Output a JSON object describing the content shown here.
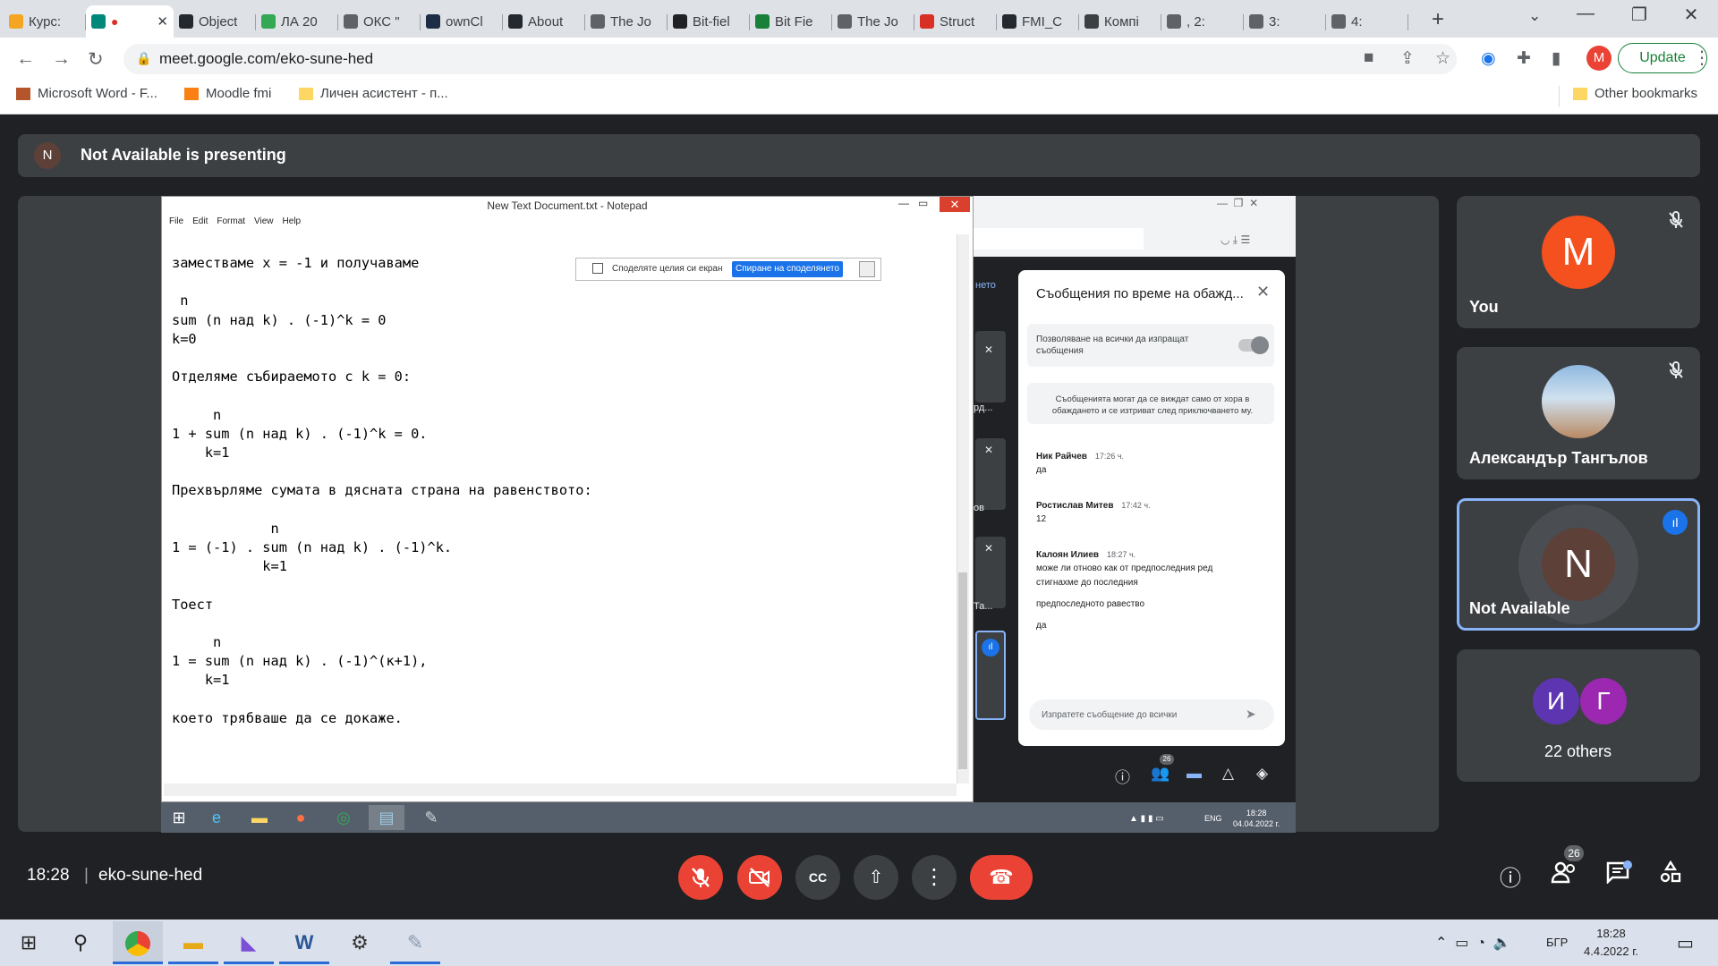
{
  "browser": {
    "tabs": [
      {
        "title": "Курс: ",
        "color": "#f4a623"
      },
      {
        "title": "",
        "color": "#00897b",
        "active": true,
        "recording": true
      },
      {
        "title": "Object",
        "color": "#24292f"
      },
      {
        "title": "ЛА 20",
        "color": "#34a853"
      },
      {
        "title": "ОКС \"",
        "color": "#5f6368"
      },
      {
        "title": "ownCl",
        "color": "#1d2d44"
      },
      {
        "title": "About",
        "color": "#24292f"
      },
      {
        "title": "The Jo",
        "color": "#5f6368"
      },
      {
        "title": "Bit-fiel",
        "color": "#202124"
      },
      {
        "title": "Bit Fie",
        "color": "#188038"
      },
      {
        "title": "The Jo",
        "color": "#5f6368"
      },
      {
        "title": "Struct",
        "color": "#d93025"
      },
      {
        "title": "FMI_C",
        "color": "#24292f"
      },
      {
        "title": "Компі",
        "color": "#3c4043"
      },
      {
        "title": ", 2:",
        "color": "#5f6368"
      },
      {
        "title": "3:",
        "color": "#5f6368"
      },
      {
        "title": "4:",
        "color": "#5f6368"
      }
    ],
    "url": "meet.google.com/eko-sune-hed",
    "profile_initial": "M",
    "update_label": "Update",
    "bookmarks": [
      "Microsoft Word - F...",
      "Moodle fmi",
      "Личен асистент - п..."
    ],
    "other_bookmarks": "Other bookmarks"
  },
  "meet": {
    "presenting_initial": "N",
    "presenting_text": "Not Available is presenting",
    "time": "18:28",
    "meeting_code": "eko-sune-hed",
    "participants_count": "26",
    "participants": [
      {
        "name": "You",
        "initial": "M",
        "color": "#f4511e",
        "muted": true
      },
      {
        "name": "Александър Тангълов",
        "muted": true
      },
      {
        "name": "Not Available",
        "initial": "N",
        "color": "#5d4037",
        "speaking": true
      },
      {
        "name": "22 others",
        "initials": [
          "И",
          "Г"
        ]
      }
    ]
  },
  "shared_screen": {
    "notepad": {
      "title": "New Text Document.txt - Notepad",
      "menu": [
        "File",
        "Edit",
        "Format",
        "View",
        "Help"
      ],
      "content": "заместваме x = -1 и получаваме\n\n n\nsum (n над k) . (-1)^k = 0\nk=0\n\nОтделяме събираемото с k = 0:\n\n     n\n1 + sum (n над k) . (-1)^k = 0.\n    k=1\n\nПрехвърляме сумата в дясната страна на равенството:\n\n            n\n1 = (-1) . sum (n над k) . (-1)^k.\n           k=1\n\nТоест\n\n     n\n1 = sum (n над k) . (-1)^(к+1),\n    k=1\n\nкоето трябваше да се докаже."
    },
    "share_bar": {
      "message": "Споделяте целия си екран",
      "stop_label": "Спиране на споделянето"
    },
    "remote_meet": {
      "share_tab": "нето",
      "side_labels": [
        "рд...",
        "ов",
        "Та..."
      ],
      "participants_badge": "26",
      "chat_panel": {
        "title": "Съобщения по време на обажд...",
        "toggle_label": "Позволяване на всички да изпращат съобщения",
        "notice": "Съобщенията могат да се виждат само от хора в обаждането и се изтриват след приключването му.",
        "messages": [
          {
            "author": "Ник Райчев",
            "time": "17:26 ч.",
            "lines": [
              "да"
            ]
          },
          {
            "author": "Ростислав Митев",
            "time": "17:42 ч.",
            "lines": [
              "12"
            ]
          },
          {
            "author": "Калоян Илиев",
            "time": "18:27 ч.",
            "lines": [
              "може ли отново как от предпоследния ред",
              "стигнахме до последния",
              "предпоследното равество",
              "да"
            ]
          }
        ],
        "input_placeholder": "Изпратете съобщение до всички"
      }
    },
    "taskbar": {
      "lang": "ENG",
      "time": "18:28",
      "date": "04.04.2022 г."
    }
  },
  "windows_taskbar": {
    "lang": "БГР",
    "time": "18:28",
    "date": "4.4.2022 г."
  }
}
